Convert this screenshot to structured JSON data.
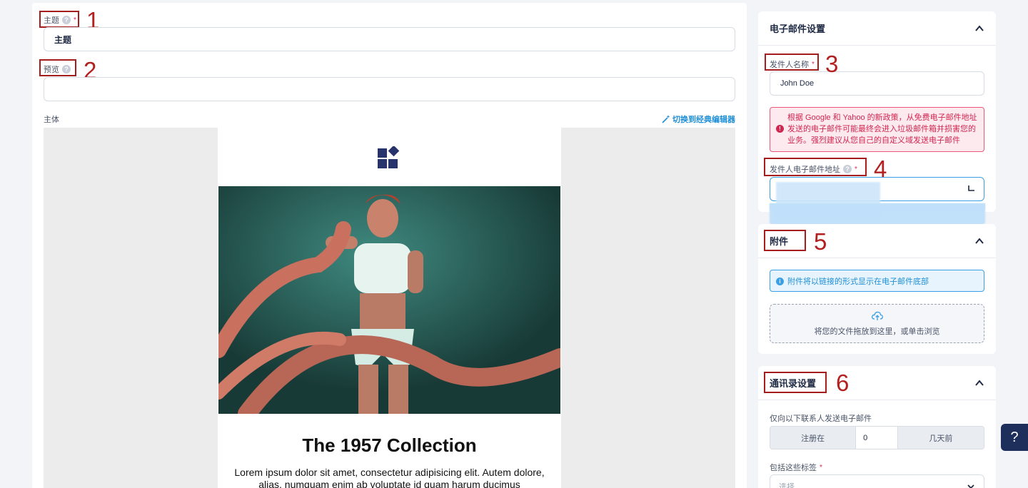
{
  "subject": {
    "label": "主题",
    "required_mark": "*",
    "value": "主题"
  },
  "preview": {
    "label": "预览",
    "value": ""
  },
  "body": {
    "label": "主体",
    "switch_link": "切换到经典编辑器"
  },
  "email": {
    "heading": "The 1957 Collection",
    "paragraph": "Lorem ipsum dolor sit amet, consectetur adipisicing elit. Autem dolore, alias, numquam enim ab voluptate id quam harum ducimus"
  },
  "annotations": [
    "1",
    "2",
    "3",
    "4",
    "5",
    "6"
  ],
  "email_settings": {
    "title": "电子邮件设置",
    "sender_name_label": "发件人名称",
    "sender_name_required": "*",
    "sender_name_value": "John Doe",
    "policy_alert": "根据 Google 和 Yahoo 的新政策，从免费电子邮件地址发送的电子邮件可能最终会进入垃圾邮件箱并损害您的业务。强烈建议从您自己的自定义域发送电子邮件",
    "sender_email_label": "发件人电子邮件地址",
    "sender_email_required": "*"
  },
  "attachments": {
    "title": "附件",
    "info": "附件将以链接的形式显示在电子邮件底部",
    "dropzone_text": "将您的文件拖放到这里，或单击浏览"
  },
  "contacts": {
    "title": "通讯录设置",
    "only_send_label": "仅向以下联系人发送电子邮件",
    "registered_label": "注册在",
    "days_value": "0",
    "days_ago_label": "几天前",
    "tags_label": "包括这些标签",
    "tags_required": "*",
    "select_placeholder": "选择"
  },
  "help_button": "?",
  "colors": {
    "accent": "#1e8fd6",
    "annotation": "#a51d1d",
    "error": "#d12651",
    "navy": "#1f2f5c"
  },
  "icons": [
    "help-circle-icon",
    "magic-wand-icon",
    "chevron-up-icon",
    "chevron-down-icon",
    "error-icon",
    "info-icon",
    "cloud-upload-icon",
    "logo-icon"
  ]
}
